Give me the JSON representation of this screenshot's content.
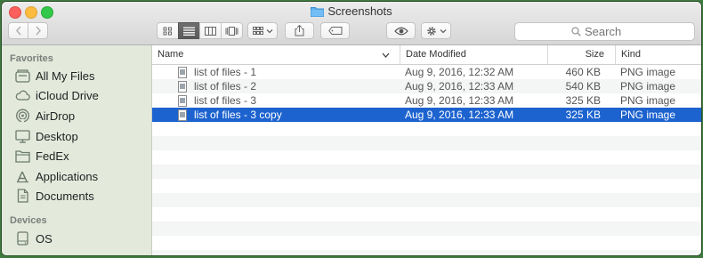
{
  "window": {
    "title": "Screenshots"
  },
  "toolbar": {
    "search_placeholder": "Search",
    "view_modes": [
      "icon-view",
      "list-view",
      "column-view",
      "cover-flow-view"
    ],
    "active_view": "list-view"
  },
  "sidebar": {
    "favorites_heading": "Favorites",
    "favorites": [
      {
        "label": "All My Files",
        "icon": "all-files-icon"
      },
      {
        "label": "iCloud Drive",
        "icon": "cloud-icon"
      },
      {
        "label": "AirDrop",
        "icon": "airdrop-icon"
      },
      {
        "label": "Desktop",
        "icon": "desktop-icon"
      },
      {
        "label": "FedEx",
        "icon": "folder-icon"
      },
      {
        "label": "Applications",
        "icon": "applications-icon"
      },
      {
        "label": "Documents",
        "icon": "documents-icon"
      }
    ],
    "devices_heading": "Devices",
    "devices": [
      {
        "label": "OS",
        "icon": "drive-icon"
      }
    ]
  },
  "list": {
    "columns": {
      "name": "Name",
      "date": "Date Modified",
      "size": "Size",
      "kind": "Kind"
    },
    "rows": [
      {
        "name": "list of files - 1",
        "date": "Aug 9, 2016, 12:32 AM",
        "size": "460 KB",
        "kind": "PNG image",
        "selected": false
      },
      {
        "name": "list of files - 2",
        "date": "Aug 9, 2016, 12:33 AM",
        "size": "540 KB",
        "kind": "PNG image",
        "selected": false
      },
      {
        "name": "list of files - 3",
        "date": "Aug 9, 2016, 12:33 AM",
        "size": "325 KB",
        "kind": "PNG image",
        "selected": false
      },
      {
        "name": "list of files - 3 copy",
        "date": "Aug 9, 2016, 12:33 AM",
        "size": "325 KB",
        "kind": "PNG image",
        "selected": true
      }
    ]
  },
  "colors": {
    "selection": "#1d63cf",
    "sidebar_bg": "#e3eadc",
    "desktop_bg": "#3f7a3f",
    "close": "#fc605c",
    "minimize": "#fdbc40",
    "zoom": "#34c84a"
  }
}
